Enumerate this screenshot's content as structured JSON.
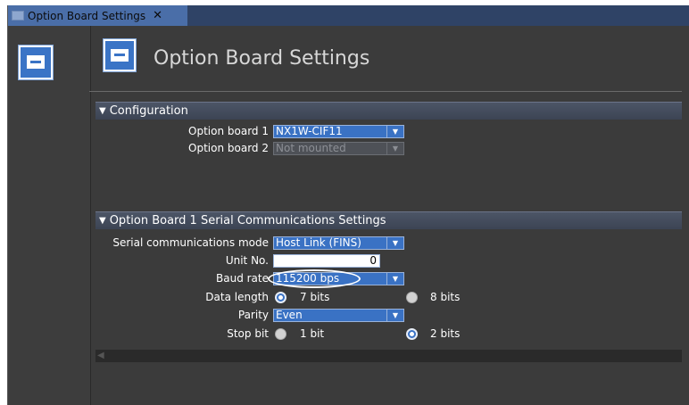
{
  "tab": {
    "title": "Option Board Settings",
    "close": "✕",
    "icon": "option-board-icon"
  },
  "header": {
    "title": "Option Board Settings"
  },
  "configuration": {
    "heading": "Configuration",
    "option_board_1": {
      "label": "Option board 1",
      "value": "NX1W-CIF11"
    },
    "option_board_2": {
      "label": "Option board 2",
      "value": "Not mounted"
    }
  },
  "serial": {
    "heading": "Option Board 1 Serial Communications Settings",
    "mode": {
      "label": "Serial communications mode",
      "value": "Host Link (FINS)"
    },
    "unit_no": {
      "label": "Unit No.",
      "value": "0"
    },
    "baud_rate": {
      "label": "Baud rate",
      "value": "115200 bps"
    },
    "data_length": {
      "label": "Data length",
      "options": [
        "7 bits",
        "8 bits"
      ],
      "selected": "7 bits"
    },
    "parity": {
      "label": "Parity",
      "value": "Even"
    },
    "stop_bit": {
      "label": "Stop bit",
      "options": [
        "1 bit",
        "2 bits"
      ],
      "selected": "2 bits"
    }
  },
  "colors": {
    "accent": "#3a72c4",
    "background": "#3b3b3b",
    "section_bar": "#4c5566"
  }
}
